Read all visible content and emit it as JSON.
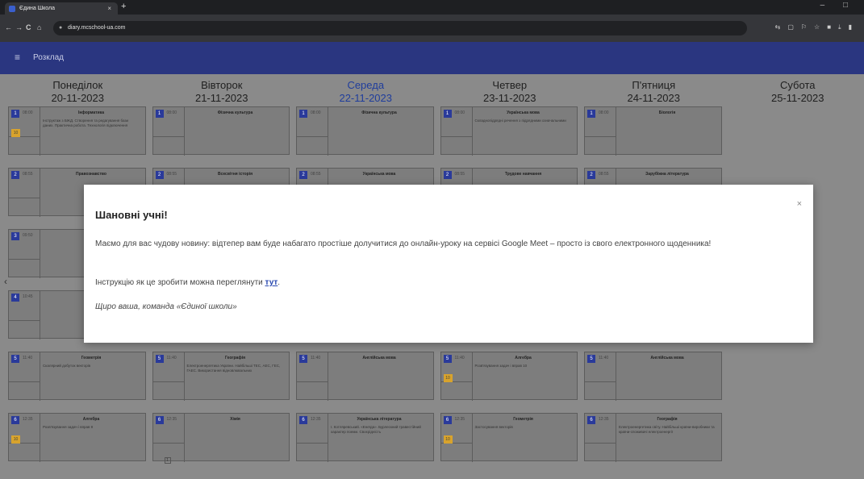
{
  "browser": {
    "tab_title": "Єдина Школа",
    "tab_close": "×",
    "new_tab": "+",
    "url": "diary.mcschool-ua.com",
    "nav": {
      "back": "←",
      "forward": "→",
      "reload": "C",
      "home": "⌂"
    }
  },
  "app": {
    "title": "Розклад",
    "menu_icon": "≡"
  },
  "days": [
    {
      "name": "Понеділок",
      "date": "20-11-2023",
      "today": false
    },
    {
      "name": "Вівторок",
      "date": "21-11-2023",
      "today": false
    },
    {
      "name": "Середа",
      "date": "22-11-2023",
      "today": true
    },
    {
      "name": "Четвер",
      "date": "23-11-2023",
      "today": false
    },
    {
      "name": "П'ятниця",
      "date": "24-11-2023",
      "today": false
    },
    {
      "name": "Субота",
      "date": "25-11-2023",
      "today": false
    }
  ],
  "lessons": {
    "row1": [
      {
        "num": "1",
        "time": "08:00",
        "subject": "Інформатика",
        "hw": "Інструктаж з БЖД. Створення та редагування бази даних. Практична робота. Технологія підключення",
        "badge": "10"
      },
      {
        "num": "1",
        "time": "08:00",
        "subject": "Фізична культура",
        "hw": ""
      },
      {
        "num": "1",
        "time": "08:00",
        "subject": "Фізична культура",
        "hw": ""
      },
      {
        "num": "1",
        "time": "08:00",
        "subject": "Українська мова",
        "hw": "Складнопідрядні речення з підрядними означальними"
      },
      {
        "num": "1",
        "time": "08:00",
        "subject": "Біологія",
        "hw": ""
      }
    ],
    "row2": [
      {
        "num": "2",
        "time": "08:55",
        "subject": "Правознавство"
      },
      {
        "num": "2",
        "time": "08:55",
        "subject": "Всесвітня історія"
      },
      {
        "num": "2",
        "time": "08:55",
        "subject": "Українська мова"
      },
      {
        "num": "2",
        "time": "08:55",
        "subject": "Трудове навчання"
      },
      {
        "num": "2",
        "time": "08:55",
        "subject": "Зарубіжна література"
      }
    ],
    "row3_num": "3",
    "row3_time": "09:50",
    "row4_num": "4",
    "row4_time": "10:45",
    "row5": [
      {
        "num": "5",
        "time": "11:40",
        "subject": "Геометрія",
        "hw": "Скалярний добуток векторів"
      },
      {
        "num": "5",
        "time": "11:40",
        "subject": "Географія",
        "hw": "Електроенергетика України. Найбільші ТЕС, АЕС, ГЕС, ГАЕС. Використання відновлювальних"
      },
      {
        "num": "5",
        "time": "11:40",
        "subject": "Англійська мова",
        "hw": ""
      },
      {
        "num": "5",
        "time": "11:40",
        "subject": "Алгебра",
        "hw": "Розв'язування задач і вправ 10",
        "badge": "10"
      },
      {
        "num": "5",
        "time": "11:40",
        "subject": "Англійська мова",
        "hw": ""
      }
    ],
    "row6": [
      {
        "num": "6",
        "time": "12:35",
        "subject": "Алгебра",
        "hw": "Розв'язування задач і вправ 9",
        "badge": "10"
      },
      {
        "num": "6",
        "time": "12:35",
        "subject": "Хімія",
        "hw": "",
        "box": "1"
      },
      {
        "num": "6",
        "time": "12:35",
        "subject": "Українська література",
        "hw": "І. Котляревський. «Енеїда». Бурлескний травестійний характер поеми. Своєрідність"
      },
      {
        "num": "6",
        "time": "12:35",
        "subject": "Геометрія",
        "hw": "Застосування векторів",
        "badge": "10"
      },
      {
        "num": "6",
        "time": "12:35",
        "subject": "Географія",
        "hw": "Електроенергетика світу. Найбільші країни-виробники та країни-споживачі електроенергії"
      }
    ]
  },
  "modal": {
    "title": "Шановні учні!",
    "close": "×",
    "p1": "Маємо для вас чудову новину: відтепер вам буде набагато простіше долучитися до онлайн-уроку на сервісі Google Meet – просто із свого електронного щоденника!",
    "p2_text": "Інструкцію як це зробити можна переглянути",
    "p2_link": "тут",
    "p3": "Щиро ваша, команда «Єдиної школи»"
  }
}
